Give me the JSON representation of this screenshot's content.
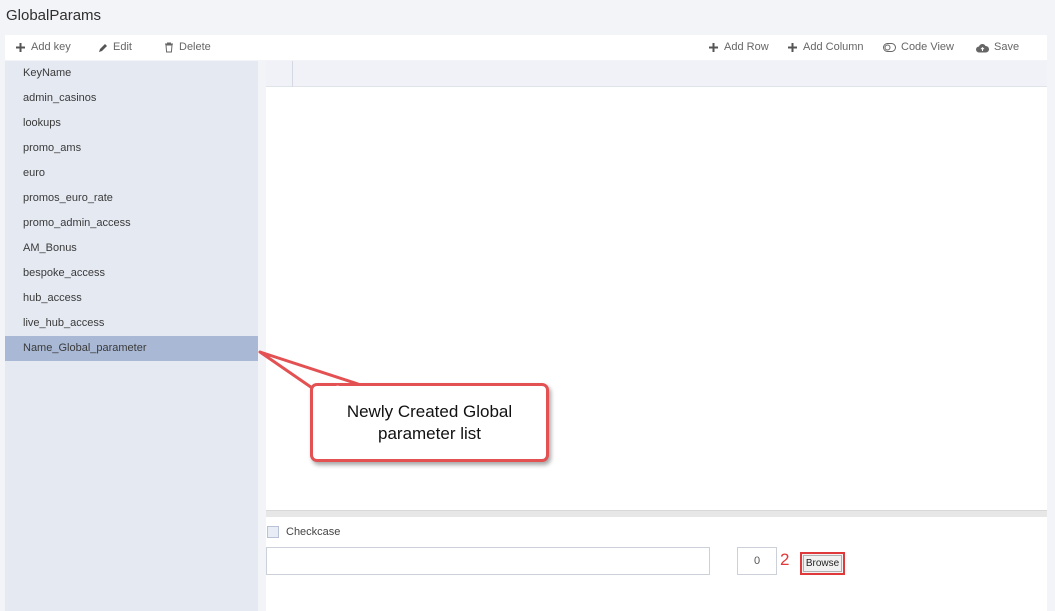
{
  "page": {
    "title": "GlobalParams"
  },
  "toolbar": {
    "add_key": "Add key",
    "edit": "Edit",
    "delete": "Delete",
    "add_row": "Add Row",
    "add_column": "Add Column",
    "code_view": "Code View",
    "save": "Save"
  },
  "sidebar": {
    "header": "KeyName",
    "items": [
      "admin_casinos",
      "lookups",
      "promo_ams",
      "euro",
      "promos_euro_rate",
      "promo_admin_access",
      "AM_Bonus",
      "bespoke_access",
      "hub_access",
      "live_hub_access",
      "Name_Global_parameter"
    ],
    "selected": "Name_Global_parameter"
  },
  "bottom": {
    "checkbox_label": "Checkcase",
    "checkbox_checked": false,
    "input_value": "",
    "count": "0",
    "browse_label": "Browse"
  },
  "annotation": {
    "callout_text": "Newly Created Global parameter list",
    "marker": "2",
    "color": "#e35153"
  }
}
